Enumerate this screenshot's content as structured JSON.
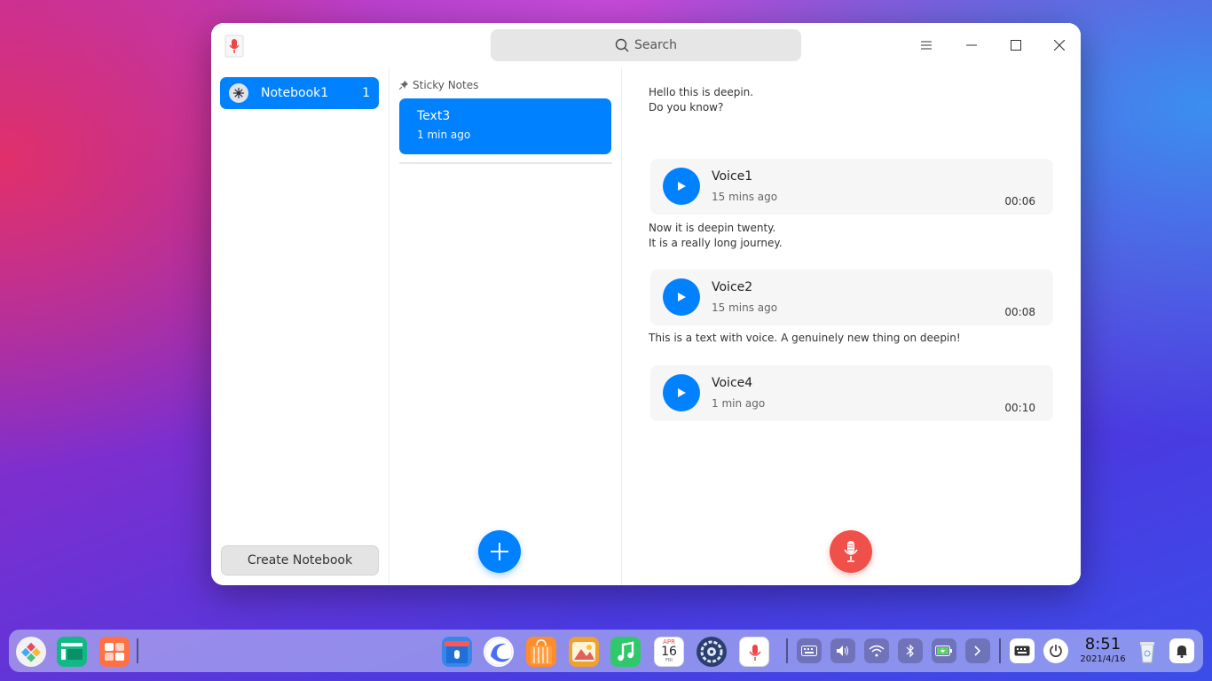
{
  "search": {
    "placeholder": "Search"
  },
  "sidebar": {
    "notebook": {
      "label": "Notebook1",
      "count": "1"
    },
    "create_label": "Create Notebook"
  },
  "notelist": {
    "header": "Sticky Notes",
    "notes": [
      {
        "title": "Text3",
        "time": "1 min ago"
      }
    ]
  },
  "editor": {
    "blocks": [
      {
        "type": "text",
        "lines": [
          "Hello this is deepin.",
          "Do you know?"
        ]
      },
      {
        "type": "voice",
        "title": "Voice1",
        "time": "15 mins ago",
        "duration": "00:06"
      },
      {
        "type": "text",
        "lines": [
          "Now it is deepin twenty.",
          "It is a really long journey."
        ]
      },
      {
        "type": "voice",
        "title": "Voice2",
        "time": "15 mins ago",
        "duration": "00:08"
      },
      {
        "type": "text",
        "lines": [
          "This is a text with voice. A genuinely new thing on deepin!"
        ]
      },
      {
        "type": "voice",
        "title": "Voice4",
        "time": "1 min ago",
        "duration": "00:10"
      }
    ]
  },
  "dock": {
    "calendar": {
      "month": "APR",
      "day": "16",
      "weekday": "FRI"
    },
    "clock": {
      "time": "8:51",
      "date": "2021/4/16"
    }
  },
  "colors": {
    "accent": "#0081ff",
    "record": "#f0504a"
  }
}
